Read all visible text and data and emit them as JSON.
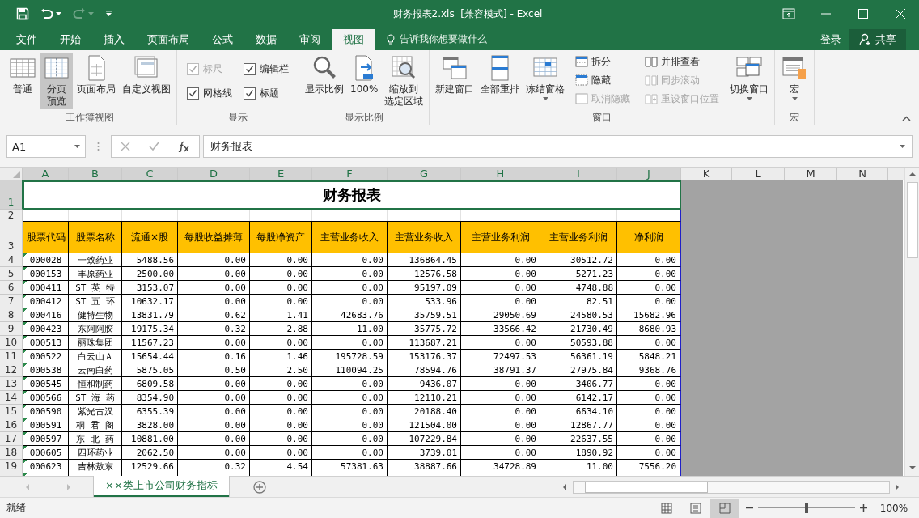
{
  "quick_access": [
    {
      "kind": "save",
      "disabled": false
    },
    {
      "kind": "undo",
      "disabled": false
    },
    {
      "kind": "redo",
      "disabled": true
    },
    {
      "kind": "customize",
      "disabled": false
    }
  ],
  "window": {
    "title": "财务报表2.xls  [兼容模式] - Excel"
  },
  "menu_tabs": [
    {
      "label": "文件",
      "selected": false
    },
    {
      "label": "开始",
      "selected": false
    },
    {
      "label": "插入",
      "selected": false
    },
    {
      "label": "页面布局",
      "selected": false
    },
    {
      "label": "公式",
      "selected": false
    },
    {
      "label": "数据",
      "selected": false
    },
    {
      "label": "审阅",
      "selected": false
    },
    {
      "label": "视图",
      "selected": true
    }
  ],
  "tell_me": {
    "placeholder": "告诉我你想要做什么"
  },
  "account": {
    "login": "登录",
    "share": "共享"
  },
  "ribbon": {
    "groups": [
      {
        "label": "工作簿视图",
        "items": [
          {
            "kind": "large",
            "label": "普通",
            "selected": false
          },
          {
            "kind": "large",
            "label": [
              "分页",
              "预览"
            ],
            "selected": true
          },
          {
            "kind": "large",
            "label": "页面布局",
            "selected": false
          },
          {
            "kind": "large",
            "label": "自定义视图",
            "selected": false
          }
        ]
      },
      {
        "label": "显示",
        "items": [
          {
            "kind": "check",
            "label": "标尺",
            "checked": true,
            "disabled": true
          },
          {
            "kind": "check",
            "label": "网格线",
            "checked": true,
            "disabled": false
          },
          {
            "kind": "check",
            "label": "编辑栏",
            "checked": true,
            "disabled": false
          },
          {
            "kind": "check",
            "label": "标题",
            "checked": true,
            "disabled": false
          }
        ]
      },
      {
        "label": "显示比例",
        "items": [
          {
            "kind": "large",
            "label": "显示比例",
            "selected": false
          },
          {
            "kind": "large",
            "label": "100%",
            "selected": false
          },
          {
            "kind": "large",
            "label": [
              "缩放到",
              "选定区域"
            ],
            "selected": false
          }
        ]
      },
      {
        "label": "窗口",
        "items": [
          {
            "kind": "large",
            "label": "新建窗口",
            "selected": false
          },
          {
            "kind": "large",
            "label": "全部重排",
            "selected": false
          },
          {
            "kind": "large",
            "label": "冻结窗格",
            "selected": false,
            "dropdown": true
          },
          {
            "kind": "stack",
            "items": [
              {
                "label": "拆分",
                "disabled": false
              },
              {
                "label": "隐藏",
                "disabled": false
              },
              {
                "label": "取消隐藏",
                "disabled": true
              }
            ]
          },
          {
            "kind": "stack",
            "items": [
              {
                "label": "并排查看",
                "disabled": false
              },
              {
                "label": "同步滚动",
                "disabled": true
              },
              {
                "label": "重设窗口位置",
                "disabled": true
              }
            ]
          },
          {
            "kind": "large",
            "label": "切换窗口",
            "selected": false,
            "dropdown": true
          }
        ]
      },
      {
        "label": "宏",
        "items": [
          {
            "kind": "large",
            "label": "宏",
            "selected": false,
            "dropdown": true
          }
        ]
      }
    ]
  },
  "formula_bar": {
    "name_box": "A1",
    "buttons": [
      {
        "kind": "cancel",
        "disabled": true
      },
      {
        "kind": "enter",
        "disabled": true
      },
      {
        "kind": "function",
        "disabled": false
      }
    ],
    "content": "财务报表"
  },
  "sheet": {
    "columns": [
      {
        "label": "A",
        "selected": true
      },
      {
        "label": "B",
        "selected": true
      },
      {
        "label": "C",
        "selected": true
      },
      {
        "label": "D",
        "selected": true
      },
      {
        "label": "E",
        "selected": true
      },
      {
        "label": "F",
        "selected": true
      },
      {
        "label": "G",
        "selected": true
      },
      {
        "label": "H",
        "selected": true
      },
      {
        "label": "I",
        "selected": true
      },
      {
        "label": "J",
        "selected": true
      },
      {
        "label": "K",
        "selected": false
      },
      {
        "label": "L",
        "selected": false
      },
      {
        "label": "M",
        "selected": false
      },
      {
        "label": "N",
        "selected": false
      }
    ],
    "title_row": {
      "number": "1",
      "selected": true,
      "title": "财务报表"
    },
    "blank_row": {
      "number": "2",
      "selected": false
    },
    "header_row": {
      "number": "3",
      "selected": false,
      "headers": [
        "股票代码",
        "股票名称",
        "流通×股",
        "每股收益摊薄",
        "每股净资产",
        "主营业务收入",
        "主营业务收入",
        "主营业务利润",
        "主营业务利润",
        "净利润"
      ]
    },
    "rows": [
      {
        "number": "4",
        "selected": false,
        "cells": [
          "000028",
          "一致药业",
          "5488.56",
          "0.00",
          "0.00",
          "0.00",
          "136864.45",
          "0.00",
          "30512.72",
          "0.00"
        ]
      },
      {
        "number": "5",
        "selected": false,
        "cells": [
          "000153",
          "丰原药业",
          "2500.00",
          "0.00",
          "0.00",
          "0.00",
          "12576.58",
          "0.00",
          "5271.23",
          "0.00"
        ]
      },
      {
        "number": "6",
        "selected": false,
        "cells": [
          "000411",
          "ST 英 特",
          "3153.07",
          "0.00",
          "0.00",
          "0.00",
          "95197.09",
          "0.00",
          "4748.88",
          "0.00"
        ]
      },
      {
        "number": "7",
        "selected": false,
        "cells": [
          "000412",
          "ST 五 环",
          "10632.17",
          "0.00",
          "0.00",
          "0.00",
          "533.96",
          "0.00",
          "82.51",
          "0.00"
        ]
      },
      {
        "number": "8",
        "selected": false,
        "cells": [
          "000416",
          "健特生物",
          "13831.79",
          "0.62",
          "1.41",
          "42683.76",
          "35759.51",
          "29050.69",
          "24580.53",
          "15682.96"
        ]
      },
      {
        "number": "9",
        "selected": false,
        "cells": [
          "000423",
          "东阿阿胶",
          "19175.34",
          "0.32",
          "2.88",
          "11.00",
          "35775.72",
          "33566.42",
          "21730.49",
          "8680.93"
        ]
      },
      {
        "number": "10",
        "selected": false,
        "cells": [
          "000513",
          "丽珠集团",
          "11567.23",
          "0.00",
          "0.00",
          "0.00",
          "113687.21",
          "0.00",
          "50593.88",
          "0.00"
        ]
      },
      {
        "number": "11",
        "selected": false,
        "cells": [
          "000522",
          "白云山Ａ",
          "15654.44",
          "0.16",
          "1.46",
          "195728.59",
          "153176.37",
          "72497.53",
          "56361.19",
          "5848.21"
        ]
      },
      {
        "number": "12",
        "selected": false,
        "cells": [
          "000538",
          "云南白药",
          "5875.05",
          "0.50",
          "2.50",
          "110094.25",
          "78594.76",
          "38791.37",
          "27975.84",
          "9368.76"
        ]
      },
      {
        "number": "13",
        "selected": false,
        "cells": [
          "000545",
          "恒和制药",
          "6809.58",
          "0.00",
          "0.00",
          "0.00",
          "9436.07",
          "0.00",
          "3406.77",
          "0.00"
        ]
      },
      {
        "number": "14",
        "selected": false,
        "cells": [
          "000566",
          "ST 海 药",
          "8354.90",
          "0.00",
          "0.00",
          "0.00",
          "12110.21",
          "0.00",
          "6142.17",
          "0.00"
        ]
      },
      {
        "number": "15",
        "selected": false,
        "cells": [
          "000590",
          "紫光古汉",
          "6355.39",
          "0.00",
          "0.00",
          "0.00",
          "20188.40",
          "0.00",
          "6634.10",
          "0.00"
        ]
      },
      {
        "number": "16",
        "selected": false,
        "cells": [
          "000591",
          "桐 君 阁",
          "3828.00",
          "0.00",
          "0.00",
          "0.00",
          "121504.00",
          "0.00",
          "12867.77",
          "0.00"
        ]
      },
      {
        "number": "17",
        "selected": false,
        "cells": [
          "000597",
          "东 北 药",
          "10881.00",
          "0.00",
          "0.00",
          "0.00",
          "107229.84",
          "0.00",
          "22637.55",
          "0.00"
        ]
      },
      {
        "number": "18",
        "selected": false,
        "cells": [
          "000605",
          "四环药业",
          "2062.50",
          "0.00",
          "0.00",
          "0.00",
          "3739.01",
          "0.00",
          "1890.92",
          "0.00"
        ]
      },
      {
        "number": "19",
        "selected": false,
        "cells": [
          "000623",
          "吉林敖东",
          "12529.66",
          "0.32",
          "4.54",
          "57381.63",
          "38887.66",
          "34728.89",
          "11.00",
          "7556.20"
        ]
      }
    ]
  },
  "sheet_tabs": [
    {
      "label": "××类上市公司财务指标",
      "selected": true
    }
  ],
  "status_bar": {
    "status": "就绪",
    "views": [
      {
        "kind": "normal",
        "selected": false
      },
      {
        "kind": "page_layout",
        "selected": false
      },
      {
        "kind": "page_break",
        "selected": true
      }
    ],
    "zoom_slider": {
      "level": 0.5
    },
    "zoom": "100%"
  }
}
